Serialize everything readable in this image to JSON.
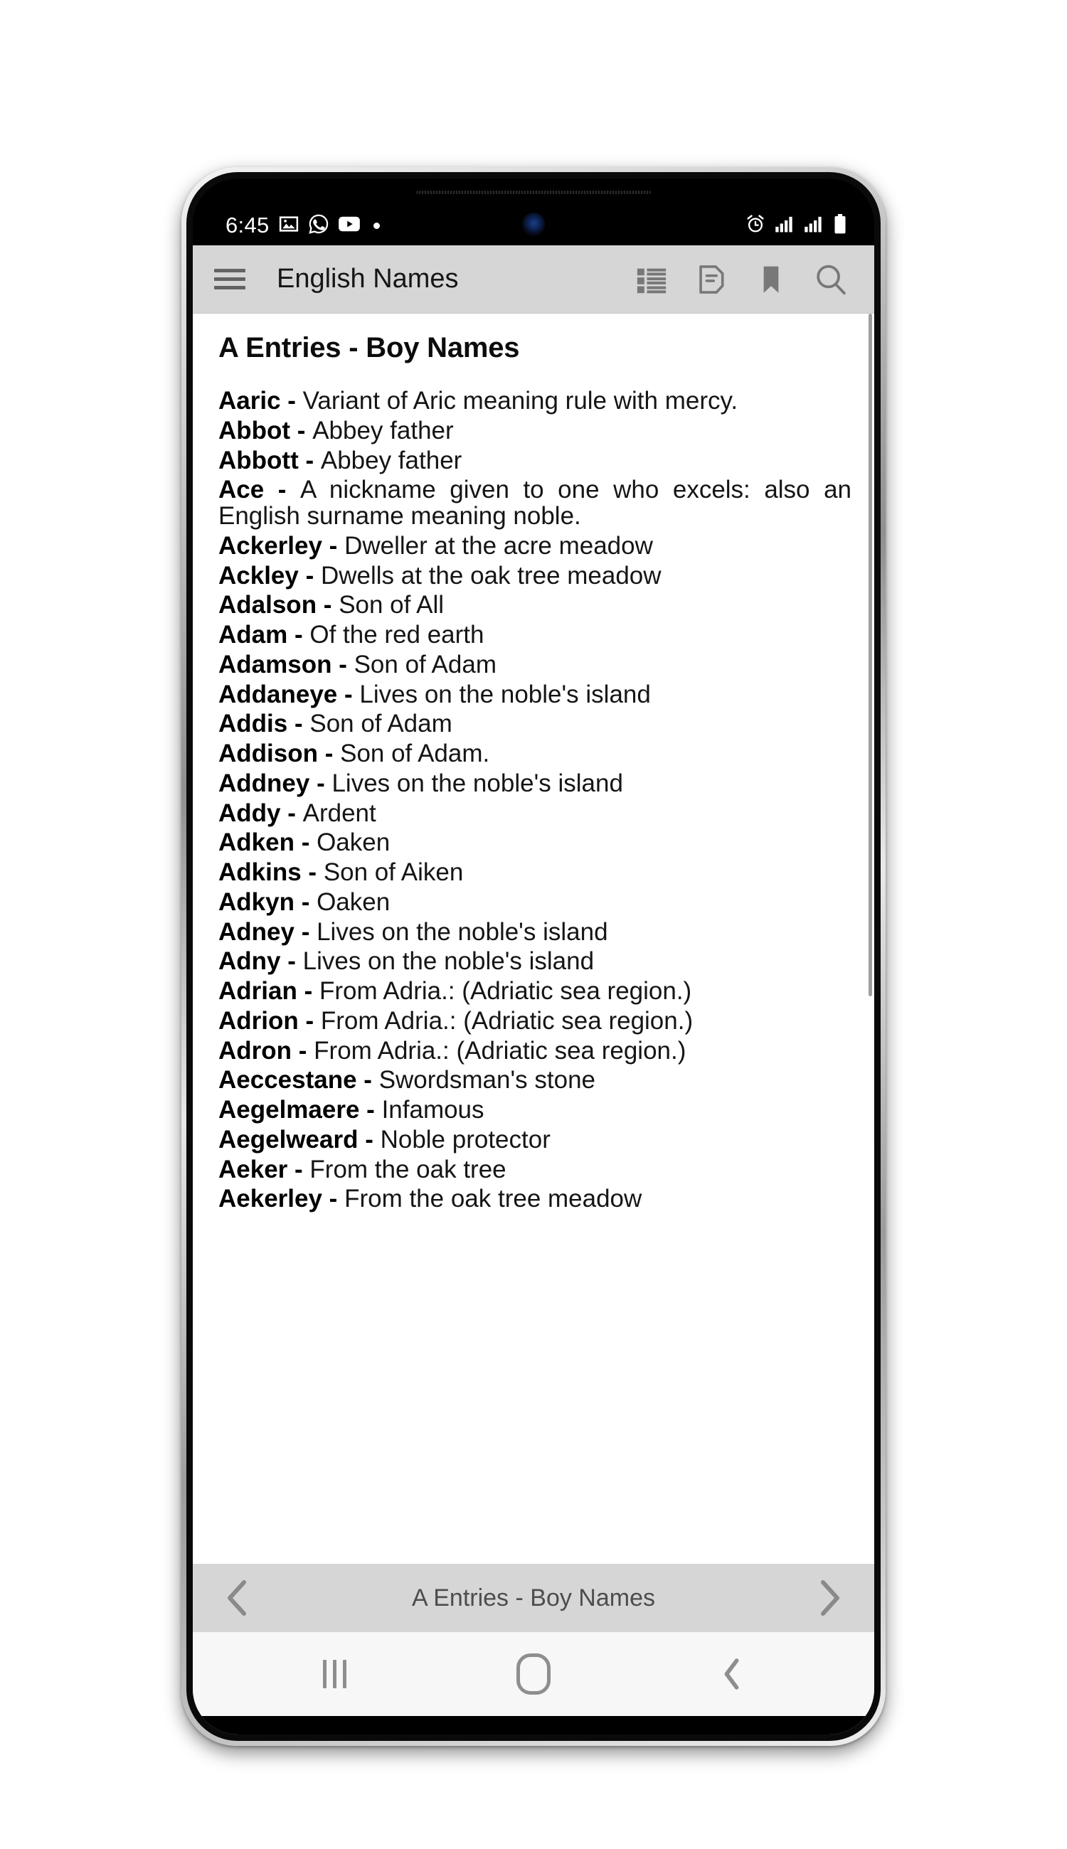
{
  "status_bar": {
    "time": "6:45",
    "left_icons": [
      "image-icon",
      "whatsapp-icon",
      "youtube-icon",
      "notification-dot"
    ],
    "right_icons": [
      "alarm-icon",
      "signal-icon",
      "signal-icon-2",
      "battery-icon"
    ]
  },
  "toolbar": {
    "menu_icon": "hamburger-menu-icon",
    "title": "English Names",
    "actions": [
      {
        "name": "list-view-icon",
        "label": "List"
      },
      {
        "name": "note-icon",
        "label": "Notes"
      },
      {
        "name": "bookmark-icon",
        "label": "Bookmarks"
      },
      {
        "name": "search-icon",
        "label": "Search"
      }
    ]
  },
  "content": {
    "heading": "A Entries - Boy Names",
    "entries": [
      {
        "name": "Aaric",
        "sep": " - ",
        "meaning": "Variant of Aric meaning rule with mercy.",
        "justified": true
      },
      {
        "name": "Abbot",
        "sep": " - ",
        "meaning": "Abbey father",
        "justified": false
      },
      {
        "name": "Abbott",
        "sep": " - ",
        "meaning": "Abbey father",
        "justified": false
      },
      {
        "name": "Ace",
        "sep": " - ",
        "meaning": "A nickname given to one who excels: also an English surname meaning noble.",
        "justified": true
      },
      {
        "name": "Ackerley",
        "sep": " - ",
        "meaning": "Dweller at the acre meadow",
        "justified": false
      },
      {
        "name": "Ackley",
        "sep": " - ",
        "meaning": "Dwells at the oak tree meadow",
        "justified": false
      },
      {
        "name": "Adalson",
        "sep": " - ",
        "meaning": "Son of All",
        "justified": false
      },
      {
        "name": "Adam",
        "sep": " - ",
        "meaning": "Of the red earth",
        "justified": false
      },
      {
        "name": "Adamson",
        "sep": " - ",
        "meaning": "Son of Adam",
        "justified": false
      },
      {
        "name": "Addaneye",
        "sep": " - ",
        "meaning": "Lives on the noble's island",
        "justified": false
      },
      {
        "name": "Addis",
        "sep": " - ",
        "meaning": "Son of Adam",
        "justified": false
      },
      {
        "name": "Addison",
        "sep": " - ",
        "meaning": "Son of Adam.",
        "justified": false
      },
      {
        "name": "Addney",
        "sep": " - ",
        "meaning": "Lives on the noble's island",
        "justified": false
      },
      {
        "name": "Addy",
        "sep": " - ",
        "meaning": "Ardent",
        "justified": false
      },
      {
        "name": "Adken",
        "sep": " - ",
        "meaning": "Oaken",
        "justified": false
      },
      {
        "name": "Adkins",
        "sep": " - ",
        "meaning": "Son of Aiken",
        "justified": false
      },
      {
        "name": "Adkyn",
        "sep": " - ",
        "meaning": "Oaken",
        "justified": false
      },
      {
        "name": "Adney",
        "sep": " - ",
        "meaning": "Lives on the noble's island",
        "justified": false
      },
      {
        "name": "Adny",
        "sep": " - ",
        "meaning": "Lives on the noble's island",
        "justified": false
      },
      {
        "name": "Adrian",
        "sep": " - ",
        "meaning": "From Adria.: (Adriatic sea region.)",
        "justified": false
      },
      {
        "name": "Adrion",
        "sep": " - ",
        "meaning": "From Adria.: (Adriatic sea region.)",
        "justified": false
      },
      {
        "name": "Adron",
        "sep": " - ",
        "meaning": "From Adria.: (Adriatic sea region.)",
        "justified": false
      },
      {
        "name": "Aeccestane",
        "sep": " - ",
        "meaning": "Swordsman's stone",
        "justified": false
      },
      {
        "name": "Aegelmaere",
        "sep": " - ",
        "meaning": "Infamous",
        "justified": false
      },
      {
        "name": "Aegelweard",
        "sep": " - ",
        "meaning": "Noble protector",
        "justified": false
      },
      {
        "name": "Aeker",
        "sep": " - ",
        "meaning": "From the oak tree",
        "justified": false
      },
      {
        "name": "Aekerley",
        "sep": " - ",
        "meaning": "From the oak tree meadow",
        "justified": false
      }
    ]
  },
  "footer": {
    "prev_icon": "chevron-left-icon",
    "title": "A Entries - Boy Names",
    "next_icon": "chevron-right-icon"
  },
  "nav_bar": {
    "recents_icon": "recents-icon",
    "home_icon": "home-icon",
    "back_icon": "back-icon"
  },
  "colors": {
    "toolbar_bg": "#d6d6d6",
    "content_bg": "#ffffff",
    "nav_bg": "#f7f7f7",
    "icon_gray": "#6f6f6f",
    "text": "#151515"
  }
}
